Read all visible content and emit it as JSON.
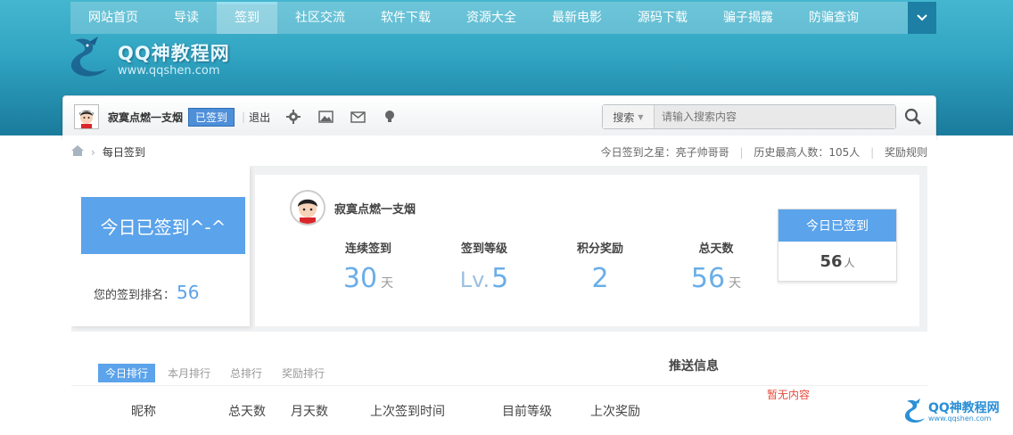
{
  "nav": {
    "items": [
      {
        "label": "网站首页"
      },
      {
        "label": "导读"
      },
      {
        "label": "签到"
      },
      {
        "label": "社区交流"
      },
      {
        "label": "软件下载"
      },
      {
        "label": "资源大全"
      },
      {
        "label": "最新电影"
      },
      {
        "label": "源码下载"
      },
      {
        "label": "骗子揭露"
      },
      {
        "label": "防骗查询"
      }
    ],
    "active_index": 2
  },
  "logo": {
    "title": "QQ神教程网",
    "url": "www.qqshen.com"
  },
  "userbar": {
    "username": "寂寞点燃一支烟",
    "signed_badge": "已签到",
    "sep": "|",
    "logout": "退出",
    "icons": [
      "gear-icon",
      "image-icon",
      "mail-icon",
      "lightbulb-icon"
    ],
    "search_type": "搜索",
    "search_placeholder": "请输入搜索内容"
  },
  "breadcrumb": {
    "page": "每日签到"
  },
  "stats_line": {
    "star": "今日签到之星：亮子帅哥哥",
    "sep": "|",
    "record": "历史最高人数：105人",
    "rules": "奖励规则"
  },
  "sign": {
    "button_label": "今日已签到^-^",
    "rank_label": "您的签到排名：",
    "rank_value": "56",
    "username": "寂寞点燃一支烟",
    "stats": [
      {
        "label": "连续签到",
        "prefix": "",
        "value": "30",
        "unit": "天"
      },
      {
        "label": "签到等级",
        "prefix": "Lv.",
        "value": "5",
        "unit": ""
      },
      {
        "label": "积分奖励",
        "prefix": "",
        "value": "2",
        "unit": ""
      },
      {
        "label": "总天数",
        "prefix": "",
        "value": "56",
        "unit": "天"
      }
    ],
    "today_box": {
      "title": "今日已签到",
      "count": "56",
      "unit": "人"
    }
  },
  "ranking": {
    "tabs": [
      {
        "label": "今日排行"
      },
      {
        "label": "本月排行"
      },
      {
        "label": "总排行"
      },
      {
        "label": "奖励排行"
      }
    ],
    "columns": [
      "昵称",
      "总天数",
      "月天数",
      "上次签到时间",
      "目前等级",
      "上次奖励"
    ],
    "push_title": "推送信息",
    "empty_text": "暂无内容"
  },
  "corner_logo": {
    "title": "QQ神教程网",
    "url": "www.qqshen.com"
  },
  "colors": {
    "accent": "#5ba3ea",
    "banner": "#2fa3c1",
    "badge": "#4e8fd9",
    "empty": "#e64b3c"
  }
}
